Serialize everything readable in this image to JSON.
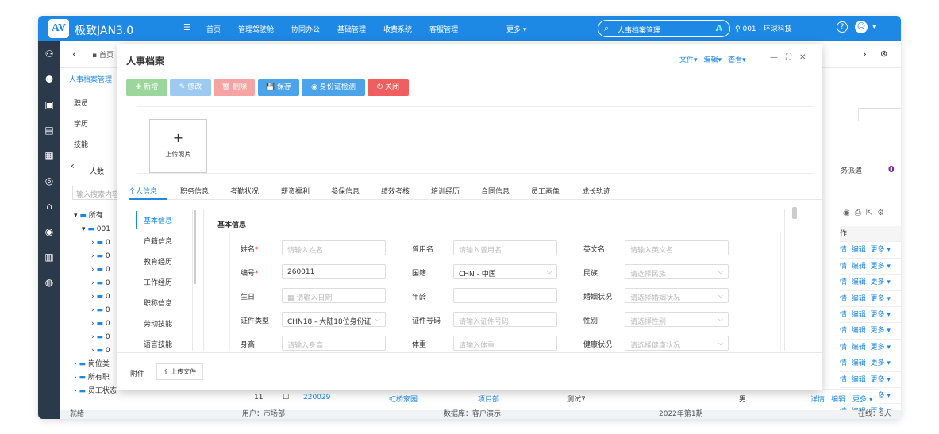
{
  "app": {
    "logo": "AV",
    "name": "极致JAN3.0"
  },
  "topnav": {
    "menu_icon": "menu-icon",
    "items": [
      "首页",
      "管理驾驶舱",
      "协同办公",
      "基础管理",
      "收费系统",
      "客服管理"
    ],
    "more": "更多 ▾"
  },
  "search": {
    "value": "人事档案管理",
    "badge": "A"
  },
  "location": "001 - 环球科技",
  "help": "?",
  "sidebar_icons": [
    "user-add-icon",
    "users-icon",
    "badge-icon",
    "document-icon",
    "calendar-icon",
    "medal-icon",
    "graduation-icon",
    "eye-icon",
    "building-icon",
    "money-bag-icon"
  ],
  "background": {
    "home_tab": "首页",
    "left_title": "人事档案管理",
    "left_items": [
      "职员",
      "学历",
      "技能"
    ],
    "count_label": "人数",
    "search_placeholder": "输入搜索内容",
    "tree": {
      "root": "所有",
      "sub": "001",
      "placeholder": "0",
      "others": [
        "岗位类",
        "所有职",
        "员工状态"
      ]
    },
    "right_label": "务派遣",
    "right_count": "0",
    "table_header": "作",
    "row_links": {
      "detail": "情",
      "edit": "编辑",
      "more": "更多 ▾"
    },
    "row11": {
      "num": "11",
      "code": "220029",
      "park": "虹桥家园",
      "dept": "项目部",
      "name": "测试7",
      "gender": "男",
      "detail": "详情",
      "edit": "编辑",
      "more": "更多 ▾"
    },
    "status": {
      "ready": "就绪",
      "user": "用户：市场部",
      "db": "数据库：客户演示",
      "period": "2022年第1期",
      "online": "在线：9人"
    }
  },
  "modal": {
    "title": "人事档案",
    "actions": [
      "文件▾",
      "编辑▾",
      "查看▾"
    ],
    "toolbar": [
      {
        "label": "新增",
        "color": "#9bd69b"
      },
      {
        "label": "修改",
        "color": "#9ccaf0"
      },
      {
        "label": "删除",
        "color": "#f5a3a3"
      },
      {
        "label": "保存",
        "color": "#4ba3ea"
      },
      {
        "label": "身份证检测",
        "color": "#4ba3ea"
      },
      {
        "label": "关闭",
        "color": "#ef5f5f"
      }
    ],
    "upload_photo": "上传照片",
    "tabs": [
      "个人信息",
      "职务信息",
      "考勤状况",
      "薪资福利",
      "参保信息",
      "绩效考核",
      "培训经历",
      "合同信息",
      "员工画像",
      "成长轨迹"
    ],
    "vnav": [
      "基本信息",
      "户籍信息",
      "教育经历",
      "工作经历",
      "职称信息",
      "劳动技能",
      "语言技能"
    ],
    "section_title": "基本信息",
    "fields": [
      {
        "label": "姓名",
        "required": true,
        "placeholder": "请输入姓名"
      },
      {
        "label": "曾用名",
        "placeholder": "请输入曾用名"
      },
      {
        "label": "英文名",
        "placeholder": "请输入英文名"
      },
      {
        "label": "编号",
        "required": true,
        "value": "260011"
      },
      {
        "label": "国籍",
        "value": "CHN - 中国",
        "select": true
      },
      {
        "label": "民族",
        "placeholder": "请选择民族",
        "select": true
      },
      {
        "label": "生日",
        "placeholder": "请输入日期",
        "date": true
      },
      {
        "label": "年龄",
        "placeholder": ""
      },
      {
        "label": "婚姻状况",
        "placeholder": "请选择婚姻状况",
        "select": true
      },
      {
        "label": "证件类型",
        "value": "CHN18 - 大陆18位身份证",
        "select": true
      },
      {
        "label": "证件号码",
        "placeholder": "请输入证件号码"
      },
      {
        "label": "性别",
        "placeholder": "请选择性别",
        "select": true
      },
      {
        "label": "身高",
        "placeholder": "请输入身高"
      },
      {
        "label": "体重",
        "placeholder": "请输入体重"
      },
      {
        "label": "健康状况",
        "placeholder": "请选择健康状况",
        "select": true
      }
    ],
    "attachment_label": "附件",
    "upload_file": "上传文件"
  }
}
